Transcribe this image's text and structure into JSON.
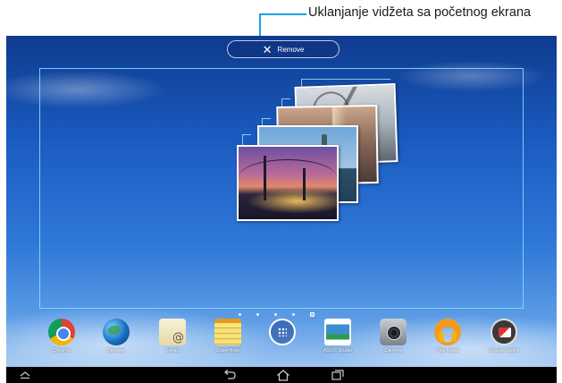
{
  "callout": {
    "text": "Uklanjanje vidžeta sa početnog ekrana",
    "color": "#1e9fe6"
  },
  "remove_bar": {
    "icon": "close-icon",
    "label": "Remove"
  },
  "widget": {
    "type": "photo-stack",
    "photos": [
      "bridge-photo",
      "statue-photo",
      "building-photo",
      "skyscraper-photo"
    ]
  },
  "page_indicator": {
    "count": 5,
    "active_index": 4
  },
  "dock": {
    "apps": [
      {
        "label": "Chrome",
        "icon": "chrome-icon"
      },
      {
        "label": "Browser",
        "icon": "browser-icon"
      },
      {
        "label": "Email",
        "icon": "email-icon"
      },
      {
        "label": "SuperNote",
        "icon": "supernote-icon"
      },
      {
        "label": "",
        "icon": "all-apps-icon"
      },
      {
        "label": "ASUS Studio",
        "icon": "asus-studio-icon"
      },
      {
        "label": "Camera",
        "icon": "camera-icon"
      },
      {
        "label": "Play Music",
        "icon": "play-music-icon"
      },
      {
        "label": "Google Settin",
        "icon": "google-settings-icon"
      }
    ]
  },
  "navbar": {
    "buttons": [
      "expand-up-icon",
      "back-icon",
      "home-icon",
      "recent-apps-icon"
    ]
  }
}
